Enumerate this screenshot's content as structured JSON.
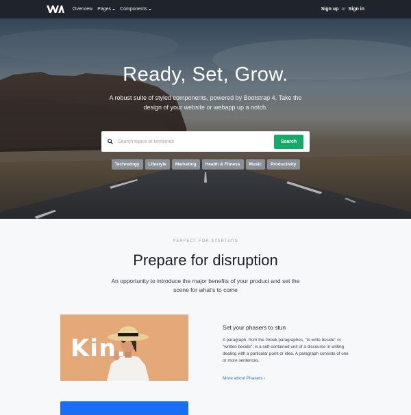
{
  "nav": {
    "links": [
      {
        "label": "Overview"
      },
      {
        "label": "Pages"
      },
      {
        "label": "Components"
      }
    ],
    "signup_label": "Sign up",
    "or_label": "or",
    "signin_label": "Sign in"
  },
  "hero": {
    "title": "Ready, Set, Grow.",
    "subtitle": "A robust suite of styled components, powered by Bootstrap 4. Take the design of your website or webapp up a notch.",
    "search": {
      "placeholder": "Search topics or keywords",
      "value": "",
      "button_label": "Search"
    },
    "tags": [
      {
        "label": "Technology"
      },
      {
        "label": "Lifestyle"
      },
      {
        "label": "Marketing"
      },
      {
        "label": "Health & Fitness"
      },
      {
        "label": "Music"
      },
      {
        "label": "Productivity"
      }
    ]
  },
  "section": {
    "eyebrow": "PERFECT FOR STARTUPS",
    "title": "Prepare for disruption",
    "subtitle": "An opportunity to introduce the major benefits of your product and set the scene for what's to come",
    "feature": {
      "image_text": "Kin.",
      "title": "Set your phasers to stun",
      "body": "A paragraph, from the Greek paragraphos, \"to write beside\" or \"written beside\", is a self-contained unit of a discourse in writing dealing with a particular point or idea. A paragraph consists of one or more sentences.",
      "link_label": "More about Phasers ›"
    }
  },
  "colors": {
    "nav_bg": "#1f232b",
    "accent_green": "#18a96a",
    "link_blue": "#2b6fd6",
    "card_blue": "#1a6ef5",
    "tag_bg": "#8a9098"
  }
}
